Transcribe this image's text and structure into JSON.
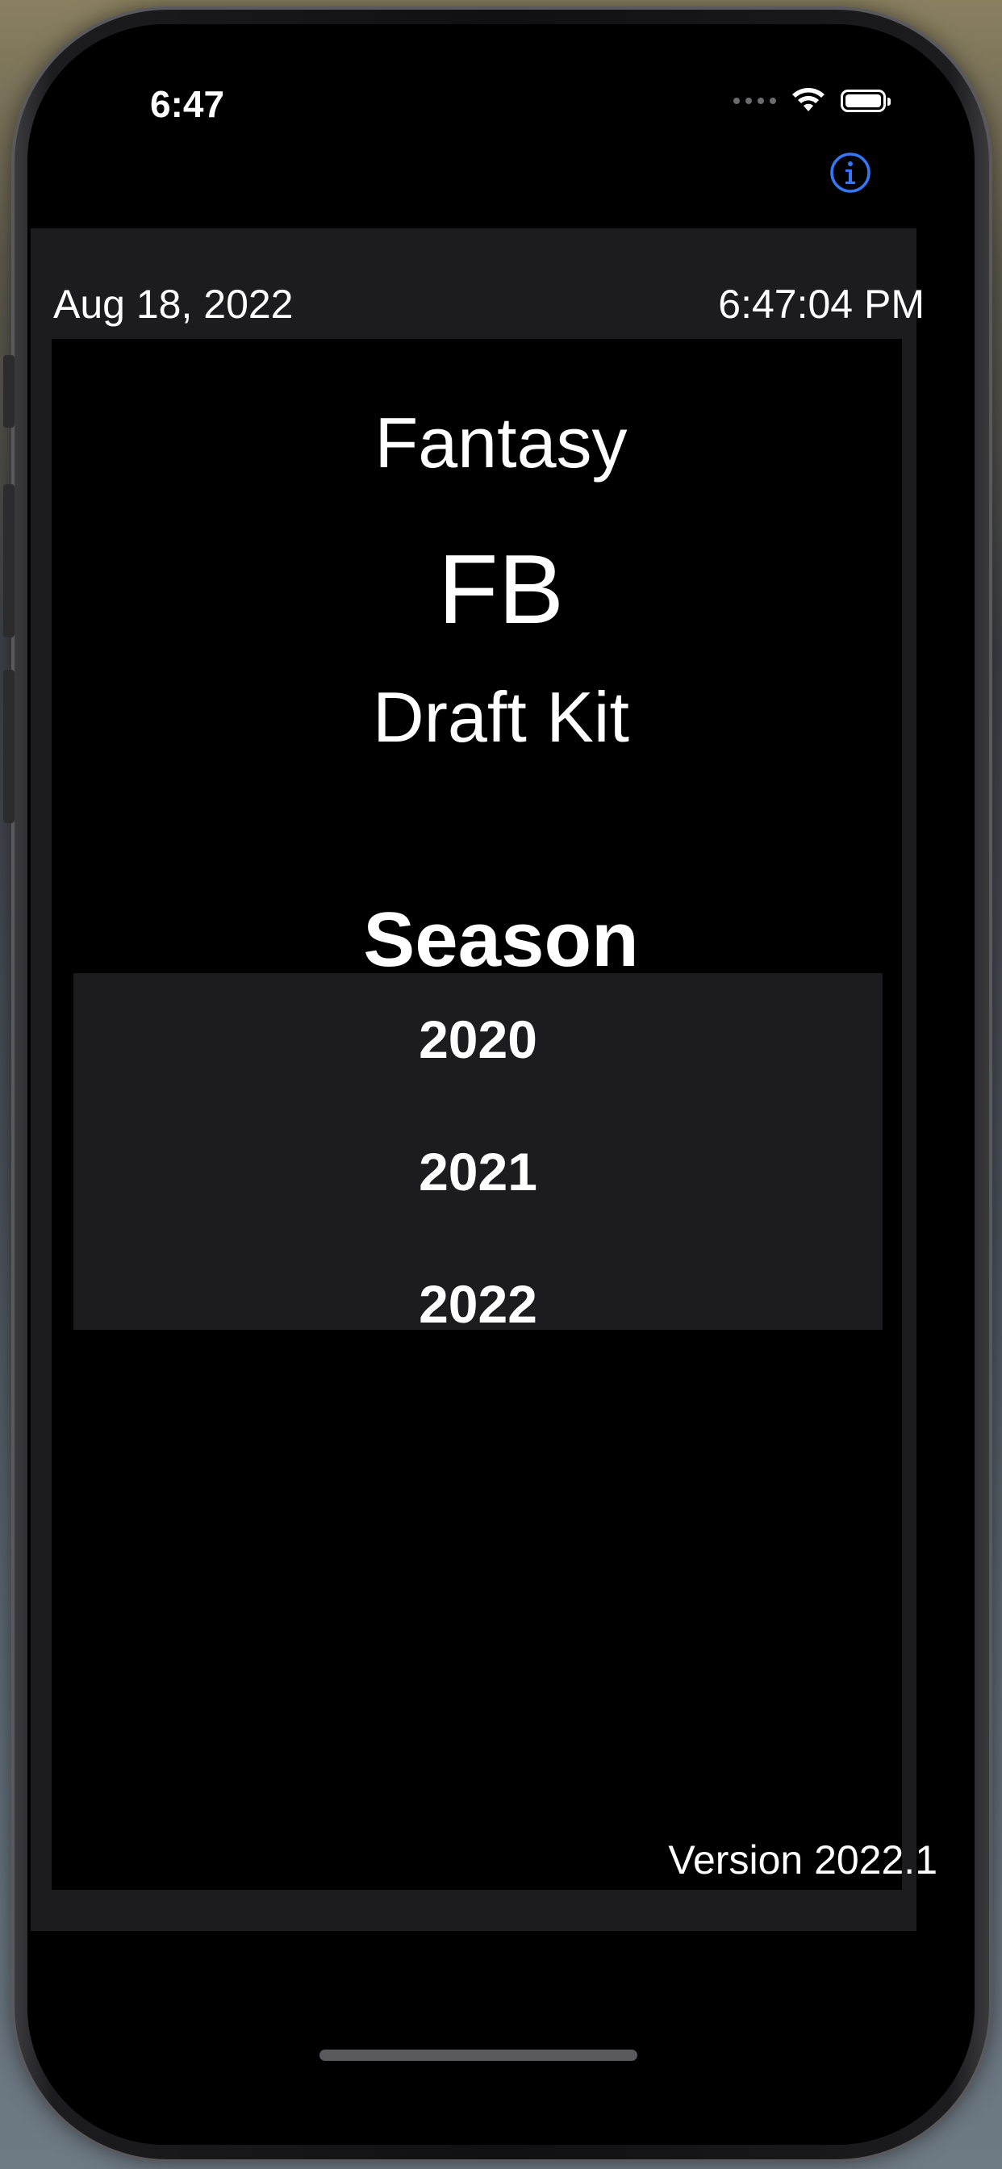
{
  "status_bar": {
    "time": "6:47",
    "icons": [
      "signal-dots-icon",
      "wifi-icon",
      "battery-icon"
    ]
  },
  "header": {
    "info_icon": "info-icon",
    "accent_color": "#3478f6",
    "date": "Aug 18, 2022",
    "time": "6:47:04 PM"
  },
  "title": {
    "line1": "Fantasy",
    "line2": "FB",
    "line3": "Draft Kit"
  },
  "season": {
    "label": "Season",
    "options": [
      "2020",
      "2021",
      "2022"
    ]
  },
  "footer": {
    "version": "Version 2022.1"
  }
}
